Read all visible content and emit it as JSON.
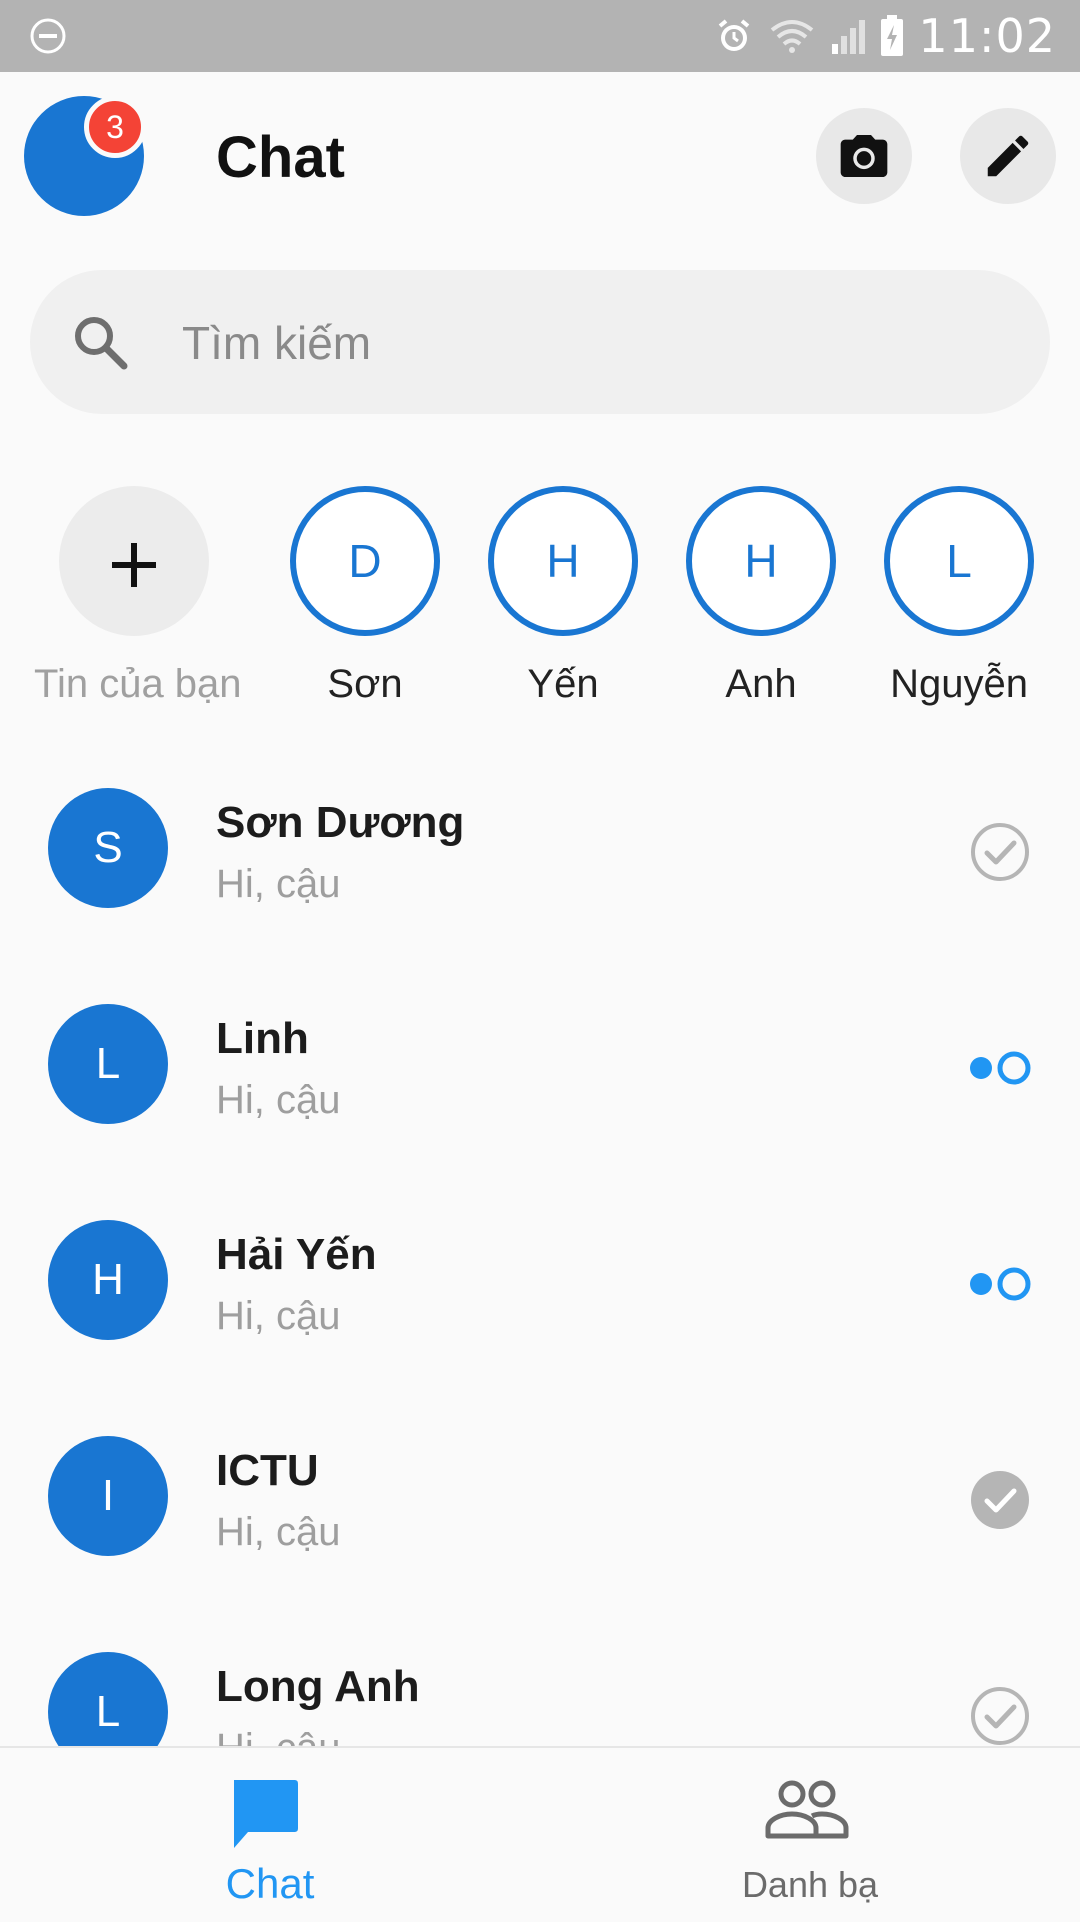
{
  "status_bar": {
    "time": "11:02"
  },
  "header": {
    "title": "Chat",
    "notification_count": "3"
  },
  "search": {
    "placeholder": "Tìm kiếm"
  },
  "stories": [
    {
      "initial": "+",
      "label": "Tin của bạn"
    },
    {
      "initial": "D",
      "label": "Sơn"
    },
    {
      "initial": "H",
      "label": "Yến"
    },
    {
      "initial": "H",
      "label": "Anh"
    },
    {
      "initial": "L",
      "label": "Nguyễn"
    }
  ],
  "chats": [
    {
      "initial": "S",
      "name": "Sơn Dương",
      "preview": "Hi, cậu",
      "status": "sent"
    },
    {
      "initial": "L",
      "name": "Linh",
      "preview": "Hi, cậu",
      "status": "sending"
    },
    {
      "initial": "H",
      "name": "Hải Yến",
      "preview": "Hi, cậu",
      "status": "sending"
    },
    {
      "initial": "I",
      "name": "ICTU",
      "preview": "Hi, cậu",
      "status": "delivered"
    },
    {
      "initial": "L",
      "name": "Long Anh",
      "preview": "Hi, cậu",
      "status": "sent"
    }
  ],
  "bottom_nav": {
    "chat_label": "Chat",
    "contacts_label": "Danh bạ"
  },
  "colors": {
    "accent": "#1976d2",
    "nav_active": "#2196f3",
    "badge": "#f44336"
  }
}
